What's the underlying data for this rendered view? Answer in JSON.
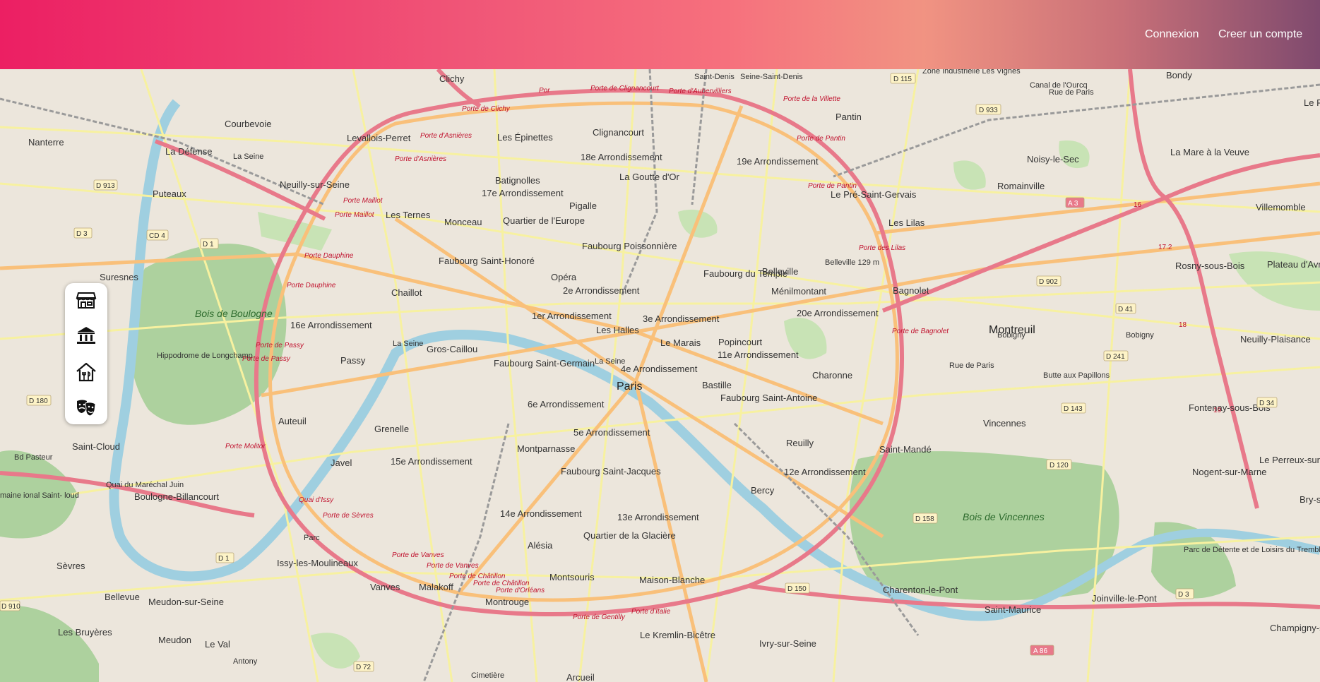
{
  "header": {
    "login": "Connexion",
    "signup": "Creer un compte"
  },
  "toolbar": {
    "items": [
      {
        "icon": "store-icon"
      },
      {
        "icon": "museum-icon"
      },
      {
        "icon": "home-icon"
      },
      {
        "icon": "theater-masks-icon"
      }
    ]
  },
  "map": {
    "labels": {
      "paris": "Paris",
      "clichy": "Clichy",
      "nanterre": "Nanterre",
      "courbevoie": "Courbevoie",
      "levallois": "Levallois-Perret",
      "la_defense": "La Défense",
      "puteaux": "Puteaux",
      "neuilly": "Neuilly-sur-Seine",
      "suresnes": "Suresnes",
      "saint_cloud": "Saint-Cloud",
      "boulogne": "Boulogne-Billancourt",
      "sevres": "Sèvres",
      "bellevue": "Bellevue",
      "les_bruyeres": "Les Bruyères",
      "meudon": "Meudon",
      "meudon_seine": "Meudon-sur-Seine",
      "le_val": "Le Val",
      "issy": "Issy-les-Moulineaux",
      "vanves": "Vanves",
      "malakoff": "Malakoff",
      "montrouge": "Montrouge",
      "arcueil": "Arcueil",
      "kremlin": "Le Kremlin-Bicêtre",
      "ivry": "Ivry-sur-Seine",
      "charenton": "Charenton-le-Pont",
      "saint_maurice": "Saint-Maurice",
      "joinville": "Joinville-le-Pont",
      "champigny": "Champigny-sur-Marne",
      "nogent": "Nogent-sur-Marne",
      "le_perreux": "Le Perreux-sur-Marne",
      "bry": "Bry-s",
      "fontenay": "Fontenay-sous-Bois",
      "vincennes": "Vincennes",
      "saint_mande": "Saint-Mandé",
      "montreuil": "Montreuil",
      "bagnolet": "Bagnolet",
      "les_lilas": "Les Lilas",
      "pre_saint_gervais": "Le Pré-Saint-Gervais",
      "pantin": "Pantin",
      "romainville": "Romainville",
      "noisy": "Noisy-le-Sec",
      "bondy": "Bondy",
      "la_mare": "La Mare à la Veuve",
      "villemomble": "Villemomble",
      "rosny": "Rosny-sous-Bois",
      "plateau": "Plateau d'Avr",
      "neuilly_plaisance": "Neuilly-Plaisance",
      "le_ra": "Le Ra",
      "batignolles": "Batignolles",
      "les_epinettes": "Les Épinettes",
      "clignancourt": "Clignancourt",
      "arr18": "18e Arrondissement",
      "goutte": "La Goutte d'Or",
      "arr17": "17e Arrondissement",
      "arr19": "19e Arrondissement",
      "les_ternes": "Les Ternes",
      "monceau": "Monceau",
      "quartier_europe": "Quartier de l'Europe",
      "pigalle": "Pigalle",
      "faubourg_poissonniere": "Faubourg Poissonnière",
      "faubourg_st_honore": "Faubourg Saint-Honoré",
      "opera": "Opéra",
      "arr2": "2e Arrondissement",
      "faubourg_temple": "Faubourg du Temple",
      "belleville": "Belleville",
      "menilmontant": "Ménilmontant",
      "arr20": "20e Arrondissement",
      "chaillot": "Chaillot",
      "arr1": "1er Arrondissement",
      "arr3": "3e Arrondissement",
      "les_halles": "Les Halles",
      "le_marais": "Le Marais",
      "popincourt": "Popincourt",
      "arr11": "11e Arrondissement",
      "arr16": "16e Arrondissement",
      "gros_caillou": "Gros-Caillou",
      "passy": "Passy",
      "faubourg_st_germain": "Faubourg Saint-Germain",
      "arr4": "4e Arrondissement",
      "bastille": "Bastille",
      "faubourg_st_antoine": "Faubourg Saint-Antoine",
      "charonne": "Charonne",
      "arr6": "6e Arrondissement",
      "auteuil": "Auteuil",
      "grenelle": "Grenelle",
      "arr5": "5e Arrondissement",
      "reuilly": "Reuilly",
      "javel": "Javel",
      "arr15": "15e Arrondissement",
      "montparnasse": "Montparnasse",
      "faubourg_st_jacques": "Faubourg Saint-Jacques",
      "arr12": "12e Arrondissement",
      "bercy": "Bercy",
      "arr14": "14e Arrondissement",
      "arr13": "13e Arrondissement",
      "alesia": "Alésia",
      "glaciere": "Quartier de la Glacière",
      "montsouris": "Montsouris",
      "maison_blanche": "Maison-Blanche",
      "bois_boulogne": "Bois de Boulogne",
      "bois_vincennes": "Bois de Vincennes",
      "hippodrome": "Hippodrome de Longchamp",
      "cimetiere": "Cimetière",
      "butte": "Butte aux Papillons",
      "belleville_alt": "Belleville 129 m",
      "parc_detente": "Parc de Détente et de Loisirs du Tremblay",
      "porte_clignancourt": "Porte de Clignancourt",
      "porte_aubervilliers": "Porte d'Aubervilliers",
      "porte_villette": "Porte de la Villette",
      "porte_pantin": "Porte de Pantin",
      "porte_pantin2": "Porte de Pantin",
      "porte_clichy": "Porte de Clichy",
      "porte_asnieres": "Porte d'Asnières",
      "porte_asnieres2": "Porte d'Asnières",
      "porte_maillot": "Porte Maillot",
      "porte_maillot2": "Porte Maillot",
      "porte_dauphine": "Porte Dauphine",
      "porte_dauphine2": "Porte Dauphine",
      "porte_lilas": "Porte des Lilas",
      "porte_bagnolet": "Porte de Bagnolet",
      "porte_passy": "Porte de Passy",
      "porte_passy2": "Porte de Passy",
      "porte_molitor": "Porte Molitor",
      "quai_issy": "Quai d'Issy",
      "porte_sevres": "Porte de Sèvres",
      "porte_vanves": "Porte de Vanves",
      "porte_vanves2": "Porte de Vanves",
      "porte_chatillon": "Porte de Châtillon",
      "porte_chatillon2": "Porte de Châtillon",
      "porte_orleans": "Porte d'Orléans",
      "porte_gentilly": "Porte de Gentilly",
      "porte_italie": "Porte d'Italie",
      "porte_por": "Por",
      "saint_denis": "Saint-Denis",
      "seine_saint_denis": "Seine-Saint-Denis",
      "zone_industrielle": "Zone Industrielle Les Vignes",
      "rue_paris": "Rue de Paris",
      "rue_paris2": "Rue de Paris",
      "bd_paris": "Canal de l'Ourcq",
      "bobigny": "Bobigny",
      "bagnolet_rd": "Bobigny",
      "la_seine": "La Seine",
      "la_seine2": "La Seine",
      "la_seine3": "La Seine",
      "pont": "Parc",
      "bvd": "Bd Pasteur",
      "route_reine": "Quai du Maréchal Juin",
      "parc_st_cloud": "maine ional Saint- loud",
      "antony": "Antony"
    },
    "shields": {
      "d115": "D 115",
      "d933": "D 933",
      "d913": "D 913",
      "d3": "D 3",
      "cd4": "CD 4",
      "d1": "D 1",
      "d180": "D 180",
      "d1b": "D 1",
      "d910": "D 910",
      "d72": "D 72",
      "d150": "D 150",
      "d158": "D 158",
      "a86": "A 86",
      "d3b": "D 3",
      "d120": "D 120",
      "d143": "D 143",
      "d241": "D 241",
      "d41": "D 41",
      "d902": "D 902",
      "a3": "A 3",
      "d34": "D 34",
      "n16": "16",
      "n17": "17.2",
      "n18": "18",
      "n19": "19"
    }
  }
}
